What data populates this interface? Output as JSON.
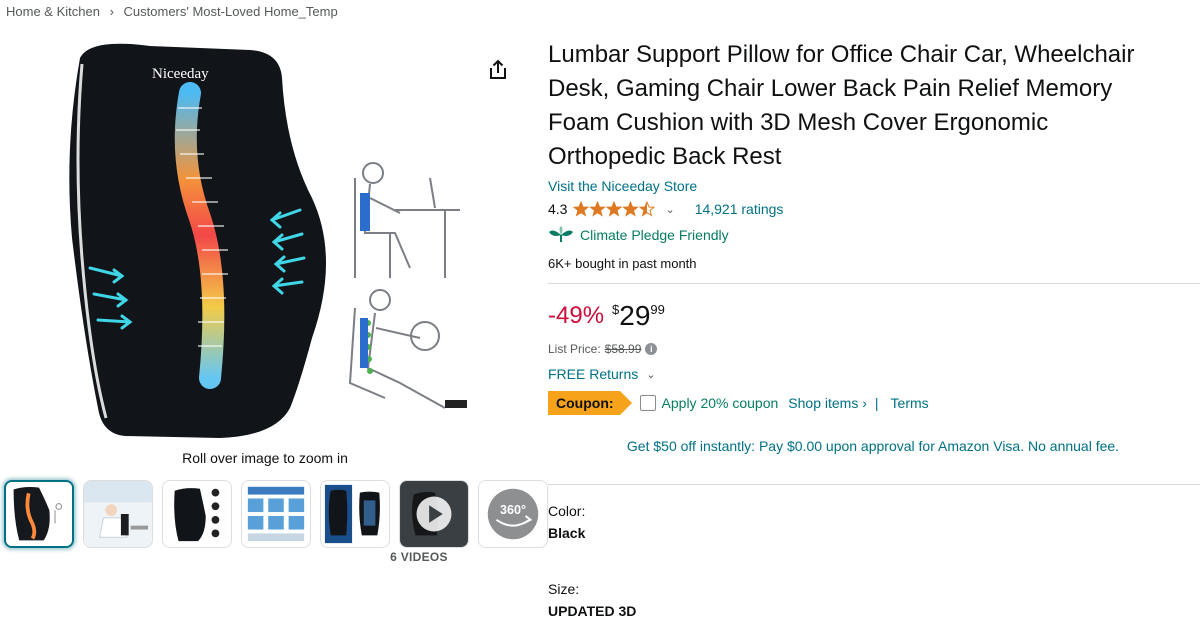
{
  "breadcrumb": {
    "items": [
      "Home & Kitchen",
      "Customers' Most-Loved Home_Temp"
    ],
    "separator": "›"
  },
  "gallery": {
    "zoom_hint": "Roll over image to zoom in",
    "brand_on_pillow": "Niceeday",
    "videos_label": "6 VIDEOS",
    "threesixty_label": "360°",
    "thumbnail_count": 7
  },
  "product": {
    "title": "Lumbar Support Pillow for Office Chair Car, Wheelchair Desk, Gaming Chair Lower Back Pain Relief Memory Foam Cushion with 3D Mesh Cover Ergonomic Orthopedic Back Rest",
    "store_link": "Visit the Niceeday Store",
    "rating": "4.3",
    "rating_value": 4.3,
    "ratings_count": "14,921 ratings",
    "climate_label": "Climate Pledge Friendly",
    "bought": "6K+ bought in past month"
  },
  "pricing": {
    "discount": "-49%",
    "currency": "$",
    "whole": "29",
    "fraction": "99",
    "list_label": "List Price:",
    "list_price": "$58.99",
    "returns": "FREE Returns"
  },
  "coupon": {
    "badge": "Coupon:",
    "text": "Apply 20% coupon",
    "shop_items": "Shop items ›",
    "pipe": "|",
    "terms": "Terms"
  },
  "promo": "Get $50 off instantly: Pay $0.00 upon approval for Amazon Visa. No annual fee.",
  "options": {
    "color_label": "Color:",
    "color_value": "Black",
    "size_label": "Size:",
    "size_value": "UPDATED 3D"
  },
  "colors": {
    "link": "#007185",
    "price_discount": "#cc0c39",
    "coupon": "#f7a21b",
    "green": "#067d62",
    "star": "#de7921"
  }
}
